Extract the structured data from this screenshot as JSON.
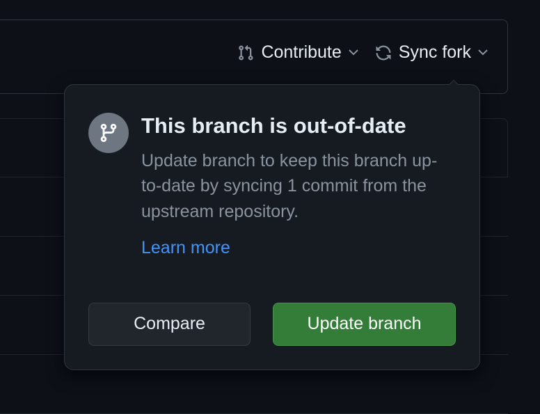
{
  "toolbar": {
    "contribute_label": "Contribute",
    "sync_fork_label": "Sync fork"
  },
  "popover": {
    "title": "This branch is out-of-date",
    "description": "Update branch to keep this branch up-to-date by syncing 1 commit from the upstream repository.",
    "learn_more_label": "Learn more",
    "compare_label": "Compare",
    "update_label": "Update branch"
  }
}
